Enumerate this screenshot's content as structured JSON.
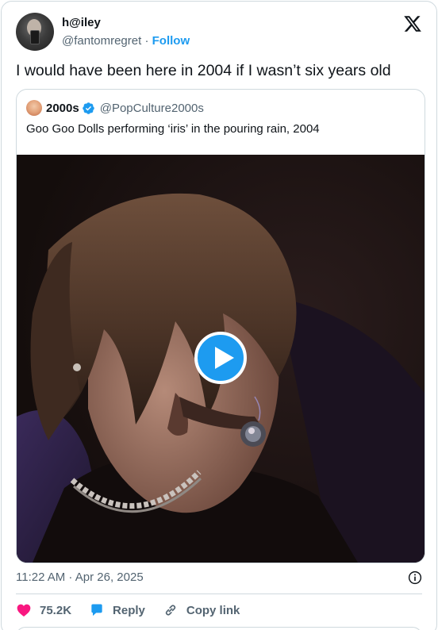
{
  "tweet": {
    "display_name": "h@iley",
    "handle": "@fantomregret",
    "separator": "·",
    "follow_label": "Follow",
    "text": "I would have been here in 2004 if I wasn’t six years old",
    "timestamp": "11:22 AM · Apr 26, 2025"
  },
  "quote": {
    "display_name": "2000s",
    "handle": "@PopCulture2000s",
    "text": "Goo Goo Dolls performing ‘iris’ in the pouring rain, 2004",
    "media": {
      "type": "video",
      "icon": "play-icon"
    }
  },
  "actions": {
    "likes": "75.2K",
    "reply_label": "Reply",
    "copy_label": "Copy link"
  },
  "colors": {
    "accent": "#1d9bf0",
    "like": "#f91880",
    "text": "#0f1419",
    "secondary": "#536471",
    "border": "#cfd9de"
  }
}
